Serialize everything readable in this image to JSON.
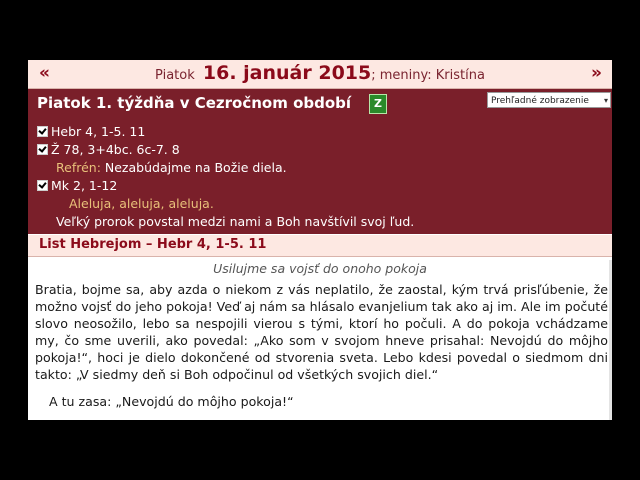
{
  "date_bar": {
    "prev": "«",
    "next": "»",
    "weekday": "Piatok",
    "date": "16. január 2015",
    "suffix": "; meniny: Kristína"
  },
  "panel": {
    "title": "Piatok 1. týždňa v Cezročnom období",
    "badge": "Z",
    "view_select": "Prehľadné zobrazenie",
    "readings": [
      "Hebr 4, 1-5. 11",
      "Ž 78, 3+4bc. 6c-7. 8"
    ],
    "refren_label": "Refrén:",
    "refren_text": "Nezabúdajme na Božie diela.",
    "gospel": "Mk 2, 1-12",
    "alleluia": "Aleluja, aleluja, aleluja.",
    "verse": "Veľký prorok povstal medzi nami a Boh navštívil svoj ľud."
  },
  "section": {
    "title": "List Hebrejom – Hebr 4, 1-5. 11"
  },
  "reading": {
    "headline": "Usilujme sa vojsť do onoho pokoja",
    "body": "Bratia, bojme sa, aby azda o niekom z vás neplatilo, že zaostal, kým trvá prisľúbenie, že možno vojsť do jeho pokoja! Veď aj nám sa hlásalo evanjelium tak ako aj im. Ale im počuté slovo neosožilo, lebo sa nespojili vierou s tými, ktorí ho počuli. A do pokoja vchádzame my, čo sme uverili, ako povedal: „Ako som v svojom hneve prisahal: Nevojdú do môjho pokoja!“, hoci je dielo dokončené od stvorenia sveta. Lebo kdesi povedal o siedmom dni takto: „V siedmy deň si Boh odpočinul od všetkých svojich diel.“",
    "next_line": "A tu zasa: „Nevojdú do môjho pokoja!“"
  },
  "colors": {
    "accent": "#8b0a1a",
    "panel_bg": "#7a1f2a",
    "header_bg": "#fde8e2",
    "refren_color": "#e8c07a"
  }
}
